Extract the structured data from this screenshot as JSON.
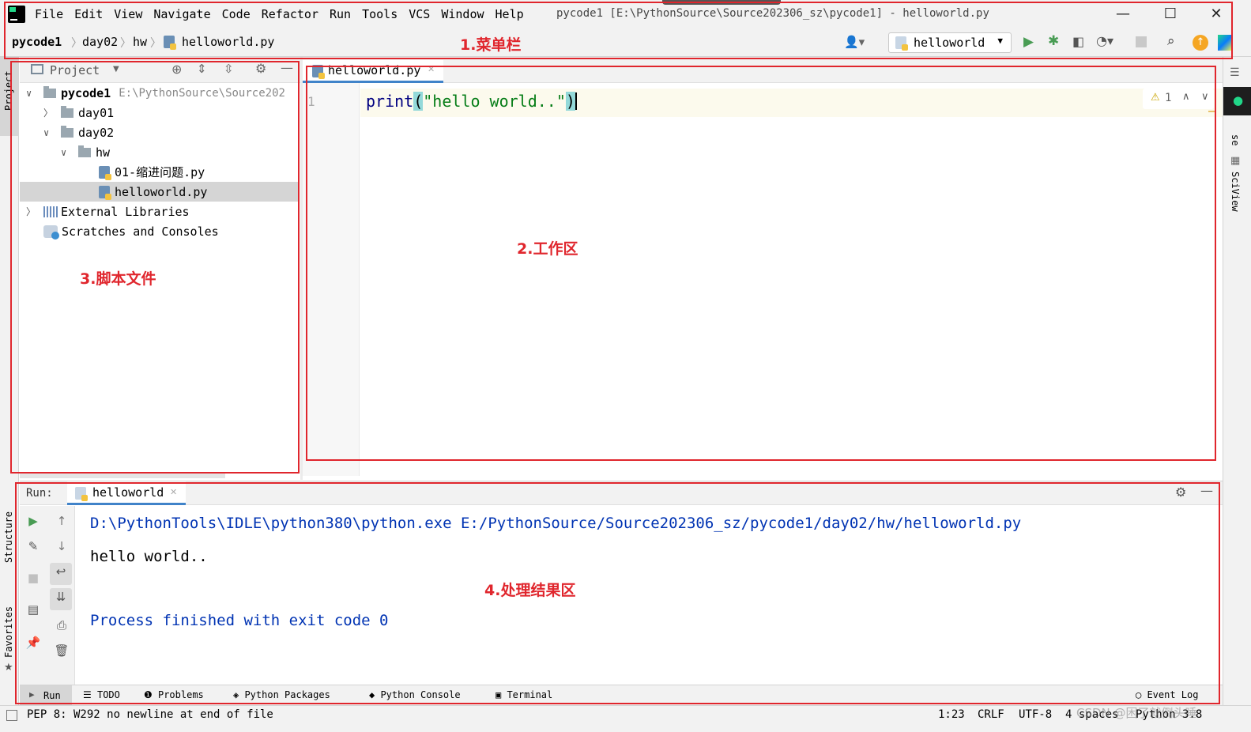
{
  "menubar": {
    "items": [
      "File",
      "Edit",
      "View",
      "Navigate",
      "Code",
      "Refactor",
      "Run",
      "Tools",
      "VCS",
      "Window",
      "Help"
    ],
    "window_title": "pycode1 [E:\\PythonSource\\Source202306_sz\\pycode1] - helloworld.py",
    "minimize": "—",
    "maximize": "☐",
    "close": "✕"
  },
  "navbar": {
    "breadcrumbs": [
      "pycode1",
      "day02",
      "hw",
      "helloworld.py"
    ],
    "run_config": "helloworld"
  },
  "annotations": {
    "menu": "1.菜单栏",
    "workspace": "2.工作区",
    "scripts": "3.脚本文件",
    "results": "4.处理结果区"
  },
  "side_strips": {
    "left_top": "Project",
    "left_mid": "Structure",
    "left_bottom": "Favorites",
    "right_mid": "SciView",
    "right_top": "se"
  },
  "project": {
    "header": "Project",
    "root_name": "pycode1",
    "root_path": "E:\\PythonSource\\Source202",
    "tree": [
      "day01",
      "day02",
      "hw",
      "01-缩进问题.py",
      "helloworld.py",
      "External Libraries",
      "Scratches and Consoles"
    ]
  },
  "editor": {
    "tab": "helloworld.py",
    "line_no": "1",
    "code_fn": "print",
    "code_open": "(",
    "code_str": "\"hello world..\"",
    "code_close": ")",
    "warnings": "1"
  },
  "run": {
    "label": "Run:",
    "tab": "helloworld",
    "cmd": "D:\\PythonTools\\IDLE\\python380\\python.exe E:/PythonSource/Source202306_sz/pycode1/day02/hw/helloworld.py",
    "output": "hello world..",
    "finished": "Process finished with exit code 0"
  },
  "tool_tabs": [
    "Run",
    "TODO",
    "Problems",
    "Python Packages",
    "Python Console",
    "Terminal"
  ],
  "event_log": "Event Log",
  "status": {
    "message": "PEP 8: W292 no newline at end of file",
    "position": "1:23",
    "line_sep": "CRLF",
    "encoding": "UTF-8",
    "indent": "4 spaces",
    "interpreter": "Python 3.8"
  },
  "watermark": "CSDN @困了就倒头睡",
  "colors": {
    "accent": "#2470b3",
    "annotation": "#e0262d",
    "run_green": "#499c54",
    "console_blue": "#0033b3",
    "string_green": "#067d17"
  }
}
